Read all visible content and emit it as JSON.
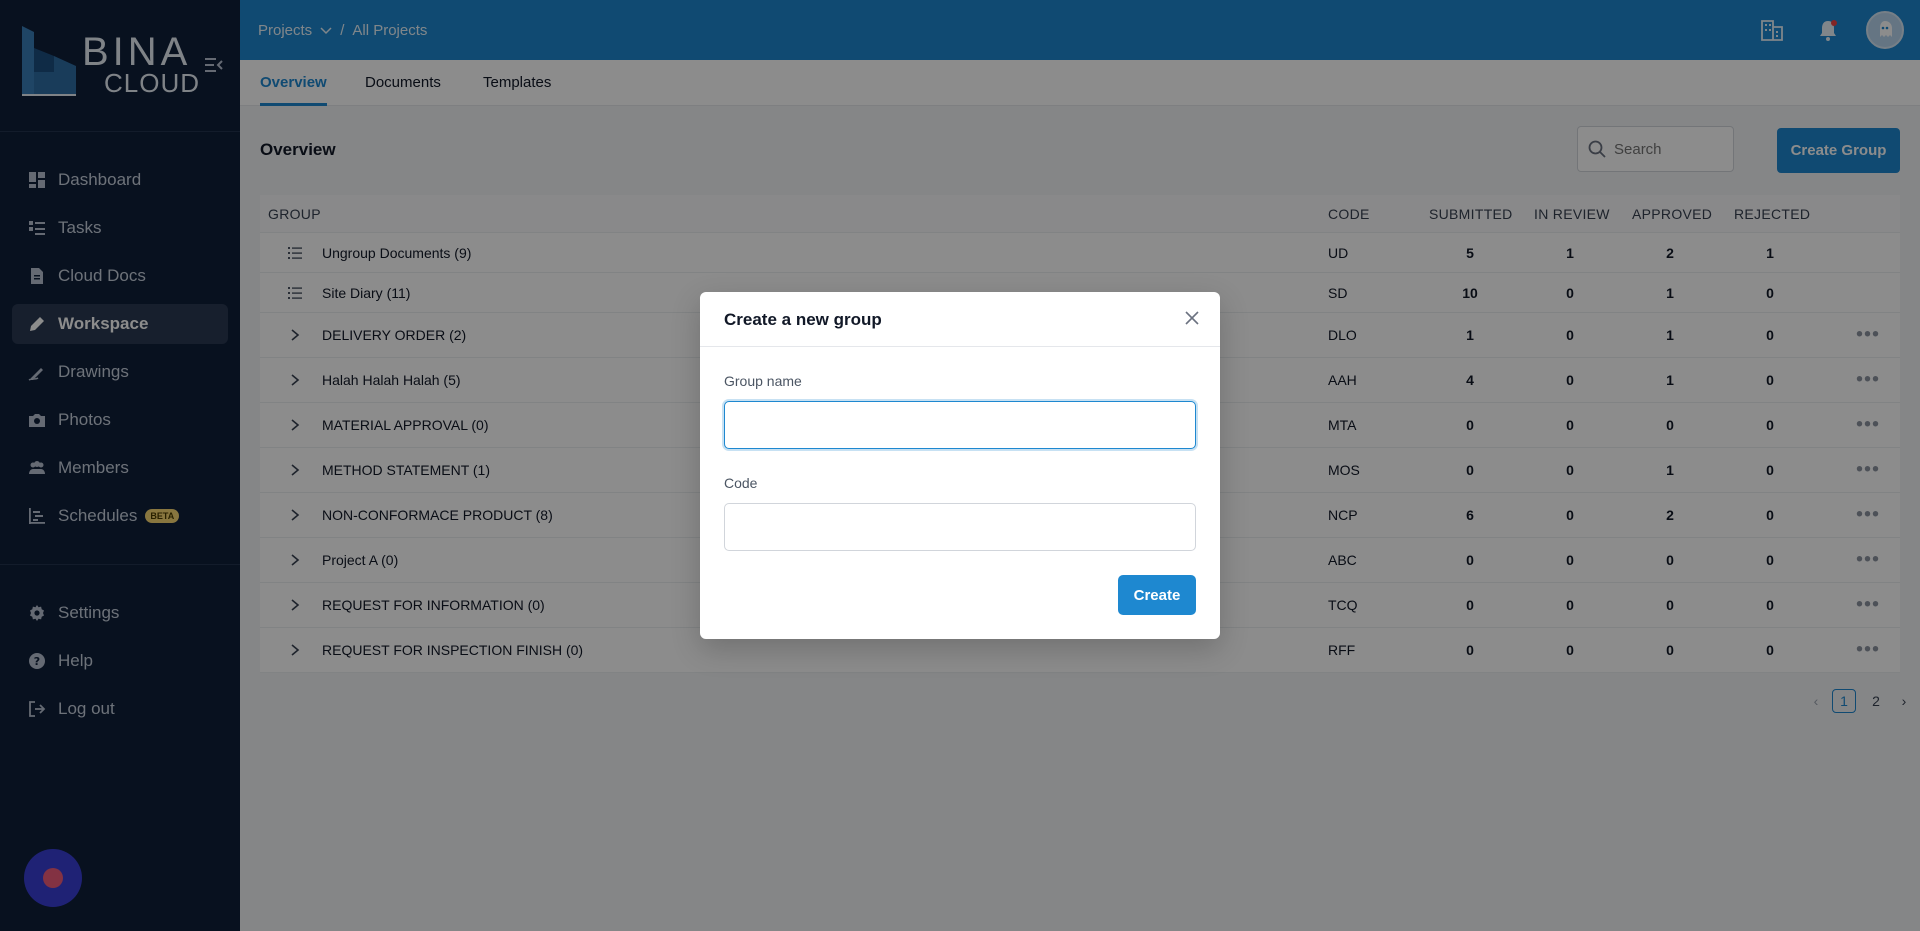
{
  "app": {
    "logo_line1": "BINA",
    "logo_line2": "CLOUD"
  },
  "sidebar": {
    "items": [
      {
        "label": "Dashboard",
        "icon": "dashboard-icon"
      },
      {
        "label": "Tasks",
        "icon": "tasks-icon"
      },
      {
        "label": "Cloud Docs",
        "icon": "document-icon"
      },
      {
        "label": "Workspace",
        "icon": "pen-icon",
        "active": true
      },
      {
        "label": "Drawings",
        "icon": "drawing-icon"
      },
      {
        "label": "Photos",
        "icon": "camera-icon"
      },
      {
        "label": "Members",
        "icon": "members-icon"
      },
      {
        "label": "Schedules",
        "icon": "chart-icon",
        "badge": "BETA"
      }
    ],
    "bottom_items": [
      {
        "label": "Settings",
        "icon": "gear-icon"
      },
      {
        "label": "Help",
        "icon": "help-icon"
      },
      {
        "label": "Log out",
        "icon": "logout-icon"
      }
    ]
  },
  "topbar": {
    "breadcrumb_root": "Projects",
    "breadcrumb_separator": "/",
    "breadcrumb_current": "All Projects"
  },
  "tabs": [
    {
      "label": "Overview",
      "active": true
    },
    {
      "label": "Documents",
      "active": false
    },
    {
      "label": "Templates",
      "active": false
    }
  ],
  "main": {
    "title": "Overview",
    "search_placeholder": "Search",
    "create_group_label": "Create Group"
  },
  "table": {
    "headers": {
      "group": "GROUP",
      "code": "CODE",
      "submitted": "SUBMITTED",
      "in_review": "IN REVIEW",
      "approved": "APPROVED",
      "rejected": "REJECTED"
    },
    "rows": [
      {
        "name": "Ungroup Documents (9)",
        "code": "UD",
        "submitted": "5",
        "in_review": "1",
        "approved": "2",
        "rejected": "1",
        "kind": "list"
      },
      {
        "name": "Site Diary (11)",
        "code": "SD",
        "submitted": "10",
        "in_review": "0",
        "approved": "1",
        "rejected": "0",
        "kind": "list"
      },
      {
        "name": "DELIVERY ORDER (2)",
        "code": "DLO",
        "submitted": "1",
        "in_review": "0",
        "approved": "1",
        "rejected": "0",
        "kind": "group"
      },
      {
        "name": "Halah Halah Halah (5)",
        "code": "AAH",
        "submitted": "4",
        "in_review": "0",
        "approved": "1",
        "rejected": "0",
        "kind": "group"
      },
      {
        "name": "MATERIAL APPROVAL (0)",
        "code": "MTA",
        "submitted": "0",
        "in_review": "0",
        "approved": "0",
        "rejected": "0",
        "kind": "group"
      },
      {
        "name": "METHOD STATEMENT (1)",
        "code": "MOS",
        "submitted": "0",
        "in_review": "0",
        "approved": "1",
        "rejected": "0",
        "kind": "group"
      },
      {
        "name": "NON-CONFORMACE PRODUCT (8)",
        "code": "NCP",
        "submitted": "6",
        "in_review": "0",
        "approved": "2",
        "rejected": "0",
        "kind": "group"
      },
      {
        "name": "Project A (0)",
        "code": "ABC",
        "submitted": "0",
        "in_review": "0",
        "approved": "0",
        "rejected": "0",
        "kind": "group"
      },
      {
        "name": "REQUEST FOR INFORMATION (0)",
        "code": "TCQ",
        "submitted": "0",
        "in_review": "0",
        "approved": "0",
        "rejected": "0",
        "kind": "group"
      },
      {
        "name": "REQUEST FOR INSPECTION FINISH (0)",
        "code": "RFF",
        "submitted": "0",
        "in_review": "0",
        "approved": "0",
        "rejected": "0",
        "kind": "group"
      }
    ]
  },
  "pagination": {
    "pages": [
      "1",
      "2"
    ],
    "current": "1"
  },
  "modal": {
    "title": "Create a new group",
    "group_name_label": "Group name",
    "group_name_value": "",
    "code_label": "Code",
    "code_value": "",
    "create_label": "Create"
  },
  "colors": {
    "accent": "#1e88d0",
    "sidebar_bg": "#0f1f3a"
  }
}
